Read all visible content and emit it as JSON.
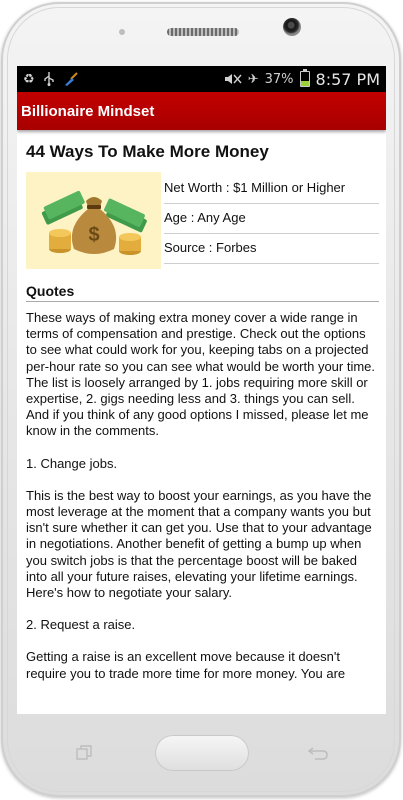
{
  "status_bar": {
    "left_icons": [
      "recycle-icon",
      "usb-icon",
      "broom-icon"
    ],
    "right_icons": [
      "mute-icon",
      "airplane-icon"
    ],
    "battery_percent": "37%",
    "battery_level": 0.37,
    "time": "8:57 PM"
  },
  "app_bar": {
    "title": "Billionaire Mindset"
  },
  "article": {
    "title": "44 Ways To Make More Money",
    "image_icon": "money-bag-icon",
    "net_worth": "Net Worth : $1 Million or Higher",
    "age": "Age : Any Age",
    "source": "Source : Forbes",
    "section_title": "Quotes",
    "paragraphs": [
      "These ways of making extra money cover a wide range in terms of compensation and prestige. Check out the options to see what could work for you, keeping tabs on a projected per-hour rate so you can see what would be worth your time. The list is loosely arranged by 1. jobs requiring more skill or expertise, 2. gigs needing less and 3. things you can sell. And if you think of any good options I missed, please let me know in the comments.",
      "1. Change jobs.",
      "This is the best way to boost your earnings, as you have the most leverage at the moment that a company wants you but isn't sure whether it can get you. Use that to your advantage in negotiations. Another benefit of getting a bump up when you switch jobs is that the percentage boost will be baked into all your future raises, elevating your lifetime earnings. Here's how to negotiate your salary.",
      "2. Request a raise.",
      "Getting a raise is an excellent move because it doesn't require you to trade more time for more money. You are"
    ]
  },
  "device": {
    "recent_apps_icon": "recent-apps-icon",
    "home_button": "home-button",
    "back_icon": "back-icon"
  }
}
